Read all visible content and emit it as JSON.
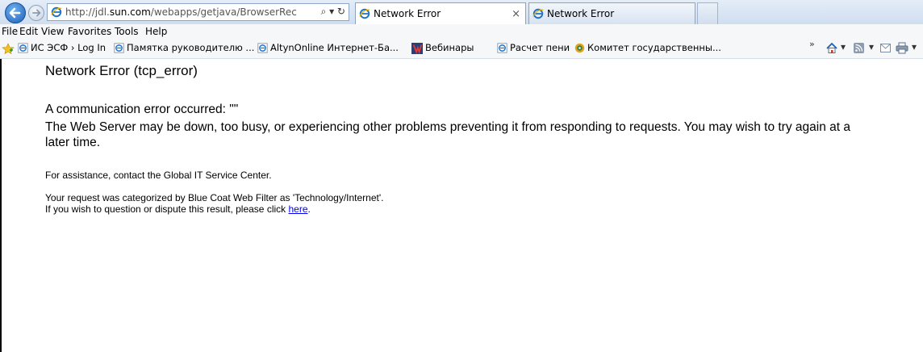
{
  "browser": {
    "url_host_prefix": "http://jdl.",
    "url_host": "sun.com",
    "url_path": "/webapps/getjava/BrowserRec",
    "url_controls": "⌕ ▾ ↻",
    "tabs": [
      {
        "label": "Network Error",
        "active": true,
        "close": "×"
      },
      {
        "label": "Network Error",
        "active": false
      }
    ]
  },
  "menu": {
    "items": [
      "File",
      "Edit",
      "View",
      "Favorites",
      "Tools",
      "Help"
    ]
  },
  "favorites": {
    "items": [
      {
        "label": "ИС ЭСФ › Log In",
        "icon": "ie-page-icon"
      },
      {
        "label": "Памятка руководителю ...",
        "icon": "ie-page-icon"
      },
      {
        "label": "AltynOnline Интернет-Ба...",
        "icon": "ie-page-icon"
      },
      {
        "label": "Вебинары",
        "icon": "webinar-icon"
      },
      {
        "label": "Расчет пени",
        "icon": "ie-page-icon"
      },
      {
        "label": "Комитет государственны...",
        "icon": "gear-badge-icon"
      }
    ],
    "overflow": "»",
    "tool_glyphs": [
      "▾",
      "▾",
      "▾",
      "▾"
    ]
  },
  "page": {
    "title": "Network Error (tcp_error)",
    "error_line": "A communication error occurred: \"\"",
    "description": "The Web Server may be down, too busy, or experiencing other problems preventing it from responding to requests. You may wish to try again at a later time.",
    "assistance": "For assistance, contact the Global IT Service Center.",
    "categorized": "Your request was categorized by Blue Coat Web Filter as 'Technology/Internet'.",
    "dispute_prefix": "If you wish to question or dispute this result, please click ",
    "dispute_link": "here",
    "dispute_suffix": "."
  }
}
